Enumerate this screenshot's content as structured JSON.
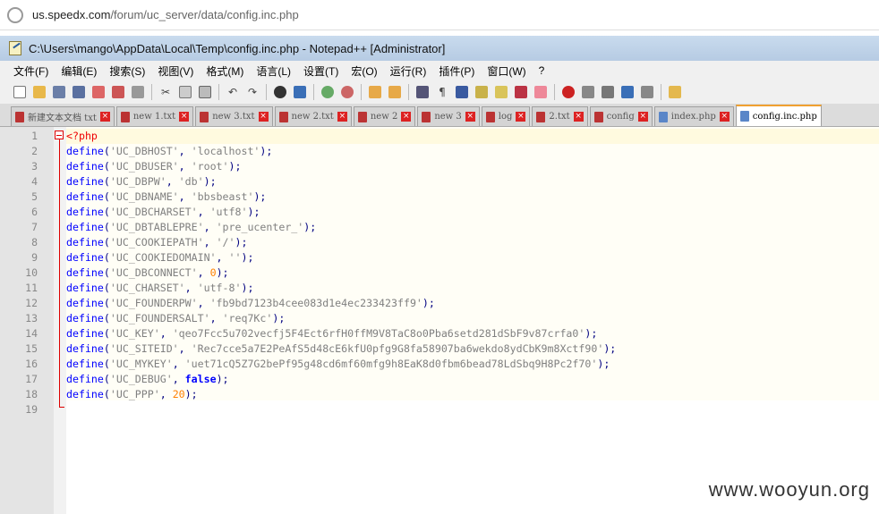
{
  "browser": {
    "url_domain": "us.speedx.com",
    "url_path": "/forum/uc_server/data/config.inc.php"
  },
  "window": {
    "title": "C:\\Users\\mango\\AppData\\Local\\Temp\\config.inc.php - Notepad++ [Administrator]"
  },
  "menu": [
    "文件(F)",
    "编辑(E)",
    "搜索(S)",
    "视图(V)",
    "格式(M)",
    "语言(L)",
    "设置(T)",
    "宏(O)",
    "运行(R)",
    "插件(P)",
    "窗口(W)",
    "?"
  ],
  "tabs": [
    {
      "label": "新建文本文档 txt",
      "active": false
    },
    {
      "label": "new 1.txt",
      "active": false
    },
    {
      "label": "new 3.txt",
      "active": false
    },
    {
      "label": "new 2.txt",
      "active": false
    },
    {
      "label": "new 2",
      "active": false
    },
    {
      "label": "new 3",
      "active": false
    },
    {
      "label": "log",
      "active": false
    },
    {
      "label": "2.txt",
      "active": false
    },
    {
      "label": "config",
      "active": false
    },
    {
      "label": "index.php",
      "active": false
    },
    {
      "label": "config.inc.php",
      "active": true
    }
  ],
  "code": {
    "line_numbers": [
      "1",
      "2",
      "3",
      "4",
      "5",
      "6",
      "7",
      "8",
      "9",
      "10",
      "11",
      "12",
      "13",
      "14",
      "15",
      "16",
      "17",
      "18",
      "19"
    ],
    "open_tag": "<?php",
    "defines": [
      {
        "key": "'UC_DBHOST'",
        "value": "'localhost'",
        "type": "str"
      },
      {
        "key": "'UC_DBUSER'",
        "value": "'root'",
        "type": "str"
      },
      {
        "key": "'UC_DBPW'",
        "value": "'db'",
        "type": "str"
      },
      {
        "key": "'UC_DBNAME'",
        "value": "'bbsbeast'",
        "type": "str"
      },
      {
        "key": "'UC_DBCHARSET'",
        "value": "'utf8'",
        "type": "str"
      },
      {
        "key": "'UC_DBTABLEPRE'",
        "value": "'pre_ucenter_'",
        "type": "str"
      },
      {
        "key": "'UC_COOKIEPATH'",
        "value": "'/'",
        "type": "str"
      },
      {
        "key": "'UC_COOKIEDOMAIN'",
        "value": "''",
        "type": "str"
      },
      {
        "key": "'UC_DBCONNECT'",
        "value": "0",
        "type": "num"
      },
      {
        "key": "'UC_CHARSET'",
        "value": "'utf-8'",
        "type": "str"
      },
      {
        "key": "'UC_FOUNDERPW'",
        "value": "'fb9bd7123b4cee083d1e4ec233423ff9'",
        "type": "str"
      },
      {
        "key": "'UC_FOUNDERSALT'",
        "value": "'req7Kc'",
        "type": "str"
      },
      {
        "key": "'UC_KEY'",
        "value": "'qeo7Fcc5u702vecfj5F4Ect6rfH0ffM9V8TaC8o0Pba6setd281dSbF9v87crfa0'",
        "type": "str"
      },
      {
        "key": "'UC_SITEID'",
        "value": "'Rec7cce5a7E2PeAfS5d48cE6kfU0pfg9G8fa58907ba6wekdo8ydCbK9m8Xctf90'",
        "type": "str"
      },
      {
        "key": "'UC_MYKEY'",
        "value": "'uet71cQ5Z7G2bePf95g48cd6mf60mfg9h8EaK8d0fbm6bead78LdSbq9H8Pc2f70'",
        "type": "str"
      },
      {
        "key": "'UC_DEBUG'",
        "value": "false",
        "type": "bool"
      },
      {
        "key": "'UC_PPP'",
        "value": "20",
        "type": "num"
      }
    ]
  },
  "watermark": "www.wooyun.org",
  "colors": {
    "keyword": "#0000ff",
    "string": "#808080",
    "number": "#ff8000",
    "php_tag": "#ee0000",
    "current_line": "#fffadf"
  }
}
